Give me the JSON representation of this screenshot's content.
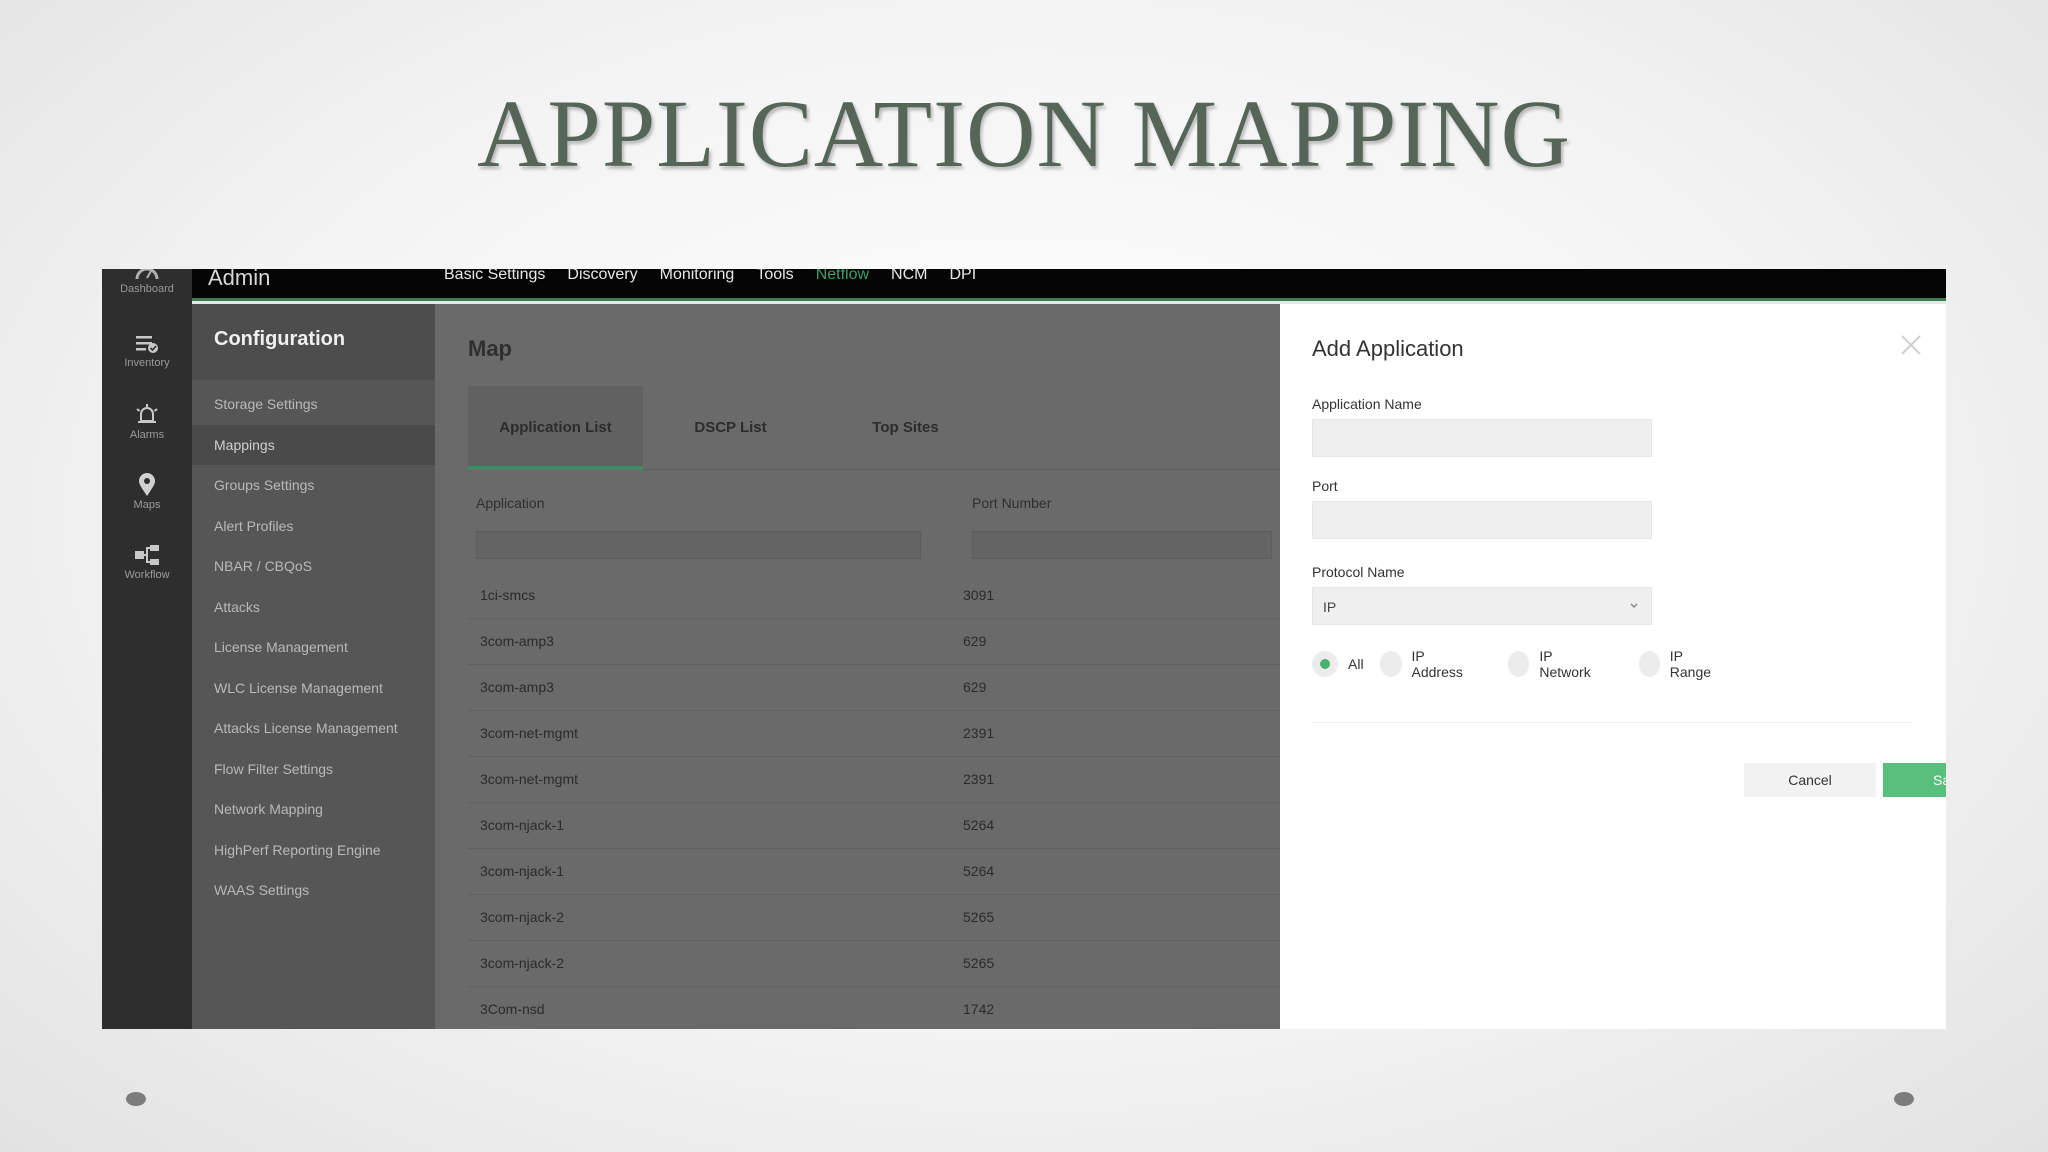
{
  "slide": {
    "title": "APPLICATION MAPPING"
  },
  "app": {
    "header": {
      "title": "Admin",
      "nav": [
        {
          "label": "Basic Settings",
          "active": false
        },
        {
          "label": "Discovery",
          "active": false
        },
        {
          "label": "Monitoring",
          "active": false
        },
        {
          "label": "Tools",
          "active": false
        },
        {
          "label": "Netflow",
          "active": true
        },
        {
          "label": "NCM",
          "active": false
        },
        {
          "label": "DPI",
          "active": false
        }
      ]
    },
    "rail": [
      {
        "label": "Dashboard",
        "icon": "dashboard-icon"
      },
      {
        "label": "Inventory",
        "icon": "inventory-icon"
      },
      {
        "label": "Alarms",
        "icon": "alarm-icon"
      },
      {
        "label": "Maps",
        "icon": "map-pin-icon"
      },
      {
        "label": "Workflow",
        "icon": "workflow-icon"
      }
    ],
    "config": {
      "title": "Configuration",
      "items": [
        "Storage Settings",
        "Mappings",
        "Groups Settings",
        "Alert Profiles",
        "NBAR / CBQoS",
        "Attacks",
        "License Management",
        "WLC License Management",
        "Attacks License Management",
        "Flow Filter Settings",
        "Network Mapping",
        "HighPerf Reporting Engine",
        "WAAS Settings"
      ],
      "selected": "Mappings"
    },
    "main": {
      "title": "Map",
      "tabs": [
        "Application List",
        "DSCP List",
        "Top Sites"
      ],
      "active_tab": "Application List",
      "columns": {
        "application": "Application",
        "port": "Port Number"
      },
      "rows": [
        {
          "app": "1ci-smcs",
          "port": "3091"
        },
        {
          "app": "3com-amp3",
          "port": "629"
        },
        {
          "app": "3com-amp3",
          "port": "629"
        },
        {
          "app": "3com-net-mgmt",
          "port": "2391"
        },
        {
          "app": "3com-net-mgmt",
          "port": "2391"
        },
        {
          "app": "3com-njack-1",
          "port": "5264"
        },
        {
          "app": "3com-njack-1",
          "port": "5264"
        },
        {
          "app": "3com-njack-2",
          "port": "5265"
        },
        {
          "app": "3com-njack-2",
          "port": "5265"
        },
        {
          "app": "3Com-nsd",
          "port": "1742"
        }
      ]
    },
    "modal": {
      "title": "Add Application",
      "fields": {
        "application_name_label": "Application Name",
        "application_name_value": "",
        "port_label": "Port",
        "port_value": "",
        "protocol_label": "Protocol Name",
        "protocol_value": "IP"
      },
      "radios": [
        {
          "label": "All",
          "checked": true
        },
        {
          "label": "IP Address",
          "checked": false
        },
        {
          "label": "IP Network",
          "checked": false
        },
        {
          "label": "IP Range",
          "checked": false
        }
      ],
      "cancel_label": "Cancel",
      "save_label": "Save"
    },
    "colors": {
      "accent_green": "#58bf7d",
      "active_nav": "#3f9e68",
      "title_color": "#556558"
    }
  }
}
